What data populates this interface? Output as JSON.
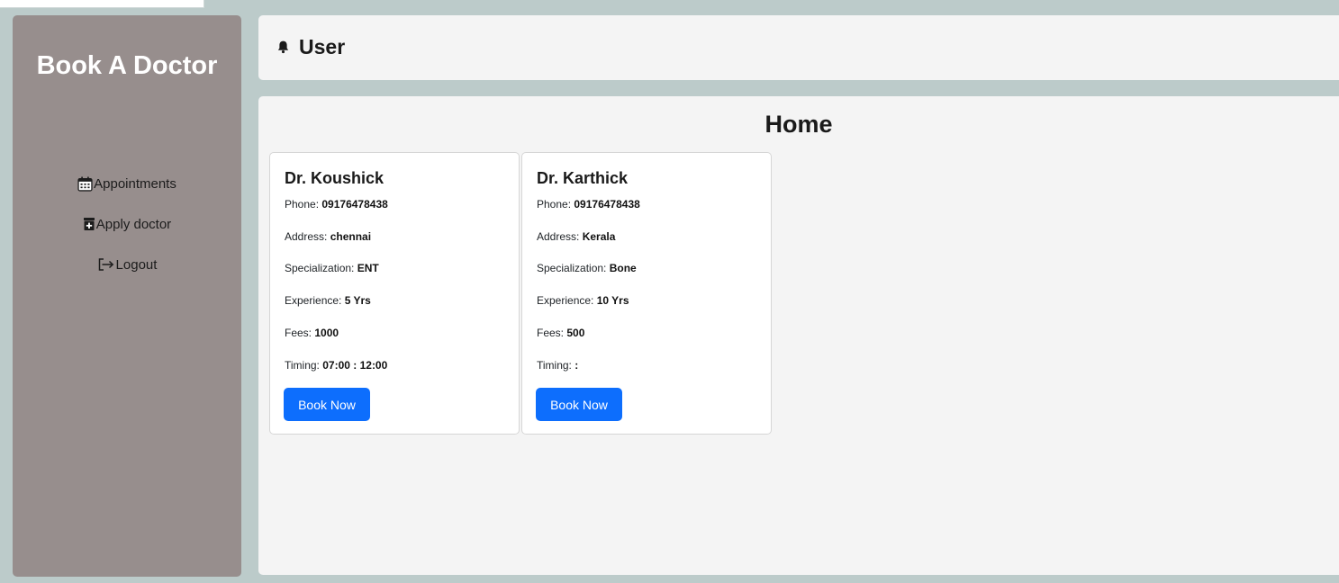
{
  "app": {
    "brand": "Book A Doctor"
  },
  "sidebar": {
    "items": [
      {
        "label": "Appointments",
        "icon": "calendar-icon"
      },
      {
        "label": "Apply doctor",
        "icon": "medical-file-icon"
      },
      {
        "label": "Logout",
        "icon": "logout-icon"
      }
    ]
  },
  "header": {
    "user_label": "User",
    "icon": "bell-icon"
  },
  "main": {
    "title": "Home"
  },
  "labels": {
    "phone": "Phone: ",
    "address": "Address: ",
    "specialization": "Specialization: ",
    "experience": "Experience: ",
    "fees": "Fees: ",
    "timing": "Timing: ",
    "book_button": "Book Now"
  },
  "doctors": [
    {
      "name": "Dr. Koushick",
      "phone": "09176478438",
      "address": "chennai",
      "specialization": "ENT",
      "experience": "5 Yrs",
      "fees": "1000",
      "timing": "07:00 : 12:00"
    },
    {
      "name": "Dr. Karthick",
      "phone": "09176478438",
      "address": "Kerala",
      "specialization": "Bone",
      "experience": "10 Yrs",
      "fees": "500",
      "timing": ":"
    }
  ],
  "colors": {
    "page_background": "#bccbca",
    "sidebar_background": "#978e8d",
    "panel_background": "#f4f4f4",
    "primary_button": "#0d6efd"
  }
}
